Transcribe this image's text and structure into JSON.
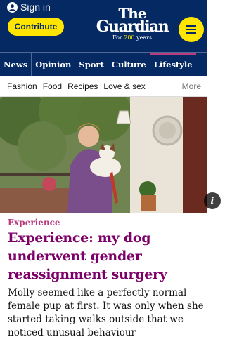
{
  "header": {
    "signin_label": "Sign in",
    "contribute_label": "Contribute",
    "masthead": {
      "line1": "The",
      "line2": "Guardian",
      "tagline_prefix": "For ",
      "tagline_years": "200",
      "tagline_suffix": " years"
    },
    "menu_icon": "hamburger-icon",
    "colors": {
      "brand": "#052962",
      "accent": "#ffe500",
      "lifestyle": "#bb3b80"
    }
  },
  "pillars": [
    "News",
    "Opinion",
    "Sport",
    "Culture",
    "Lifestyle"
  ],
  "active_pillar": "Lifestyle",
  "subnav": {
    "items": [
      "Fashion",
      "Food",
      "Recipes",
      "Love & sex"
    ],
    "more_label": "More"
  },
  "hero": {
    "info_label": "i"
  },
  "article": {
    "kicker": "Experience",
    "headline": "Experience: my dog underwent gender reassignment surgery",
    "standfirst": "Molly seemed like a perfectly normal female pup at first. It was only when she started taking walks outside that we noticed unusual behaviour"
  }
}
